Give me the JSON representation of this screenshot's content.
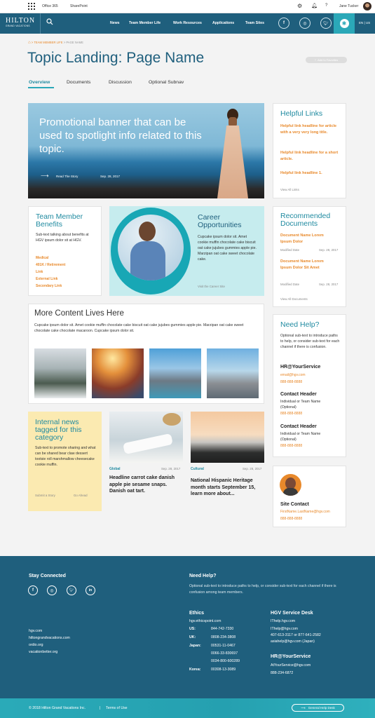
{
  "topbar": {
    "office365": "Office 365",
    "sharepoint": "SharePoint",
    "user_name": "Jane Tucker",
    "help": "?"
  },
  "nav": {
    "logo_main": "HILTON",
    "logo_sub": "GRAND VACATIONS",
    "items": [
      "News",
      "Team Member Life",
      "Work Resources",
      "Applications",
      "Team Sites"
    ],
    "lang": "EN | US"
  },
  "breadcrumb": {
    "parent": "TEAM MEMBER LIFE",
    "sep": ">",
    "current": "PAGE NAME"
  },
  "page": {
    "title": "Topic Landing: Page Name",
    "favorite_label": "Add to Favorites"
  },
  "tabs": [
    "Overview",
    "Documents",
    "Discussion",
    "Optional Subnav"
  ],
  "banner": {
    "text": "Promotional banner that can be used to spotlight info related to this topic.",
    "cta": "Read The Story",
    "date": "Sep. 28, 2017"
  },
  "helpful_links": {
    "title": "Helpful Links",
    "links": [
      "Helpful link headline for article with a very very long title.",
      "Helpful link headline for a short article.",
      "Helpful link headline 1."
    ],
    "view_all": "View All Links"
  },
  "benefits": {
    "title": "Team Member Benefits",
    "desc": "Sub-text talking about benefits at HGV ipsum dolor sit at HGV.",
    "links": [
      "Medical",
      "401K / Retirement",
      "Link",
      "External Link",
      "Secondary Link"
    ]
  },
  "career": {
    "title": "Career Opportunities",
    "desc": "Cupcake ipsum dolor sit. Amet cookie muffin chocolate cake biscuit oat cake jujubes gummies apple pie. Marzipan oat cake sweet chocolate cake.",
    "link": "Visit the Career Site"
  },
  "recommended": {
    "title": "Recommended Documents",
    "docs": [
      {
        "name": "Document Name Lorem Ipsum Dolor",
        "label": "Modified Date",
        "date": "Sep. 28, 2017"
      },
      {
        "name": "Document Name Lorem Ipsum Dolor Sit Amet",
        "label": "Modified Date",
        "date": "Sep. 28, 2017"
      }
    ],
    "view_all": "View All Documents"
  },
  "more_content": {
    "title": "More Content Lives Here",
    "desc": "Cupcake ipsum dolor sit. Amet cookie muffin chocolate cake biscuit oat cake jujubes gummies apple pie. Marzipan oat cake sweet chocolate cake chocolate macaroon. Cupcake ipsum dolor sit."
  },
  "need_help_card": {
    "title": "Need Help?",
    "desc": "Optional sub-text to introduce paths to help, or consider sub-text for each channel if there is confusion.",
    "hr_title": "HR@YourService",
    "hr_email": "email@hgv.com",
    "hr_phone": "888-888-8888",
    "contacts": [
      {
        "title": "Contact Header",
        "desc": "Individual or Team Name (Optional)",
        "phone": "888-888-8888"
      },
      {
        "title": "Contact Header",
        "desc": "Individual or Team Name (Optional)",
        "phone": "888-888-8888"
      }
    ]
  },
  "internal_news": {
    "title": "Internal news tagged for this category",
    "desc": "Sub-text to promote sharing and what can be shared bear claw dessert tootsie roll marshmallow cheesecake cookie muffin.",
    "submit": "Submit a Story",
    "go": "Go Ahead"
  },
  "news": [
    {
      "tag": "Global",
      "date": "Sep. 28, 2017",
      "headline": "Headline carrot cake danish apple pie sesame snaps. Danish oat tart."
    },
    {
      "tag": "Cultural",
      "date": "Sep. 28, 2017",
      "headline": "National Hispanic Heritage month starts September 15, learn more about..."
    }
  ],
  "site_contact": {
    "title": "Site Contact",
    "email": "FirstName.LastName@hgv.com",
    "phone": "888-888-8888"
  },
  "footer": {
    "stay_connected": "Stay Connected",
    "sites": [
      "hgv.com",
      "hiltongrandvacations.com",
      "ordio.org",
      "vacationbetter.org"
    ],
    "help_title": "Need Help?",
    "help_desc": "Optional sub-text to introduce paths to help, or consider sub-text for each channel if there is confusion among team members.",
    "ethics_title": "Ethics",
    "ethics_site": "hgv.ethicspoint.com",
    "ethics_rows": [
      {
        "label": "US:",
        "value": "844-742-7330"
      },
      {
        "label": "UK:",
        "value": "0808-234-3808"
      },
      {
        "label": "Japan:",
        "value": "00531-11-0467"
      },
      {
        "label": "",
        "value": "0066-33-830697"
      },
      {
        "label": "",
        "value": "0034-800-600289"
      },
      {
        "label": "Korea:",
        "value": "00308-13-3089"
      }
    ],
    "desk_title": "HGV Service Desk",
    "desk_lines": [
      "IThelp.hgv.com",
      "IThelp@hgv.com",
      "407-613-3117 or 877-641-2582",
      "asiahelp@hgv.com (Japan)"
    ],
    "hr_title": "HR@YourService",
    "hr_lines": [
      "AtYourService@hgv.com",
      "888-234-6872"
    ],
    "copyright": "© 2018 Hilton Grand Vacations Inc.",
    "divider": "|",
    "terms": "Terms of Use",
    "help_desk": "General Help Desk"
  }
}
